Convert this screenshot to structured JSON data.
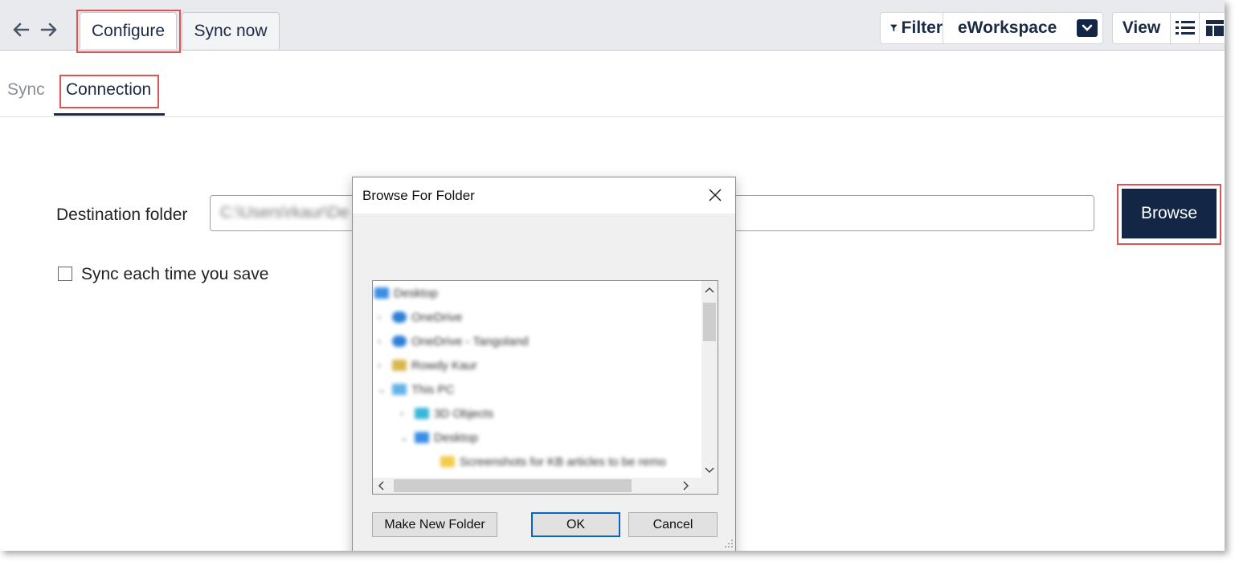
{
  "toolbar": {
    "back_icon": "arrow-left-icon",
    "forward_icon": "arrow-right-icon",
    "configure_label": "Configure",
    "sync_now_label": "Sync now",
    "filter_label": "Filter",
    "filter_icon": "funnel-icon",
    "workspace_value": "eWorkspace",
    "view_label": "View",
    "list_icon": "list-icon",
    "layout_icon": "layout-icon"
  },
  "subtabs": {
    "sync_label": "Sync",
    "connection_label": "Connection",
    "active": "Connection"
  },
  "form": {
    "destination_label": "Destination folder",
    "destination_value": "C:\\Users\\rkaur\\De",
    "browse_label": "Browse",
    "sync_save_label": "Sync each time you save",
    "sync_save_checked": false
  },
  "dialog": {
    "title": "Browse For Folder",
    "tree": [
      {
        "label": "Desktop",
        "icon": "folder-blue-icon"
      },
      {
        "label": "OneDrive",
        "icon": "cloud-icon"
      },
      {
        "label": "OneDrive - Tangoland",
        "icon": "cloud-icon"
      },
      {
        "label": "Rowdy Kaur",
        "icon": "user-folder-icon"
      },
      {
        "label": "This PC",
        "icon": "pc-icon"
      },
      {
        "label": "3D Objects",
        "icon": "3d-objects-icon"
      },
      {
        "label": "Desktop",
        "icon": "folder-blue-icon"
      },
      {
        "label": "Screenshots for KB articles to be remo",
        "icon": "folder-yellow-icon"
      }
    ],
    "make_new_folder_label": "Make New Folder",
    "ok_label": "OK",
    "cancel_label": "Cancel"
  },
  "colors": {
    "accent_navy": "#132646",
    "highlight_red": "#e15353",
    "toolbar_bg": "#e9eaee"
  }
}
